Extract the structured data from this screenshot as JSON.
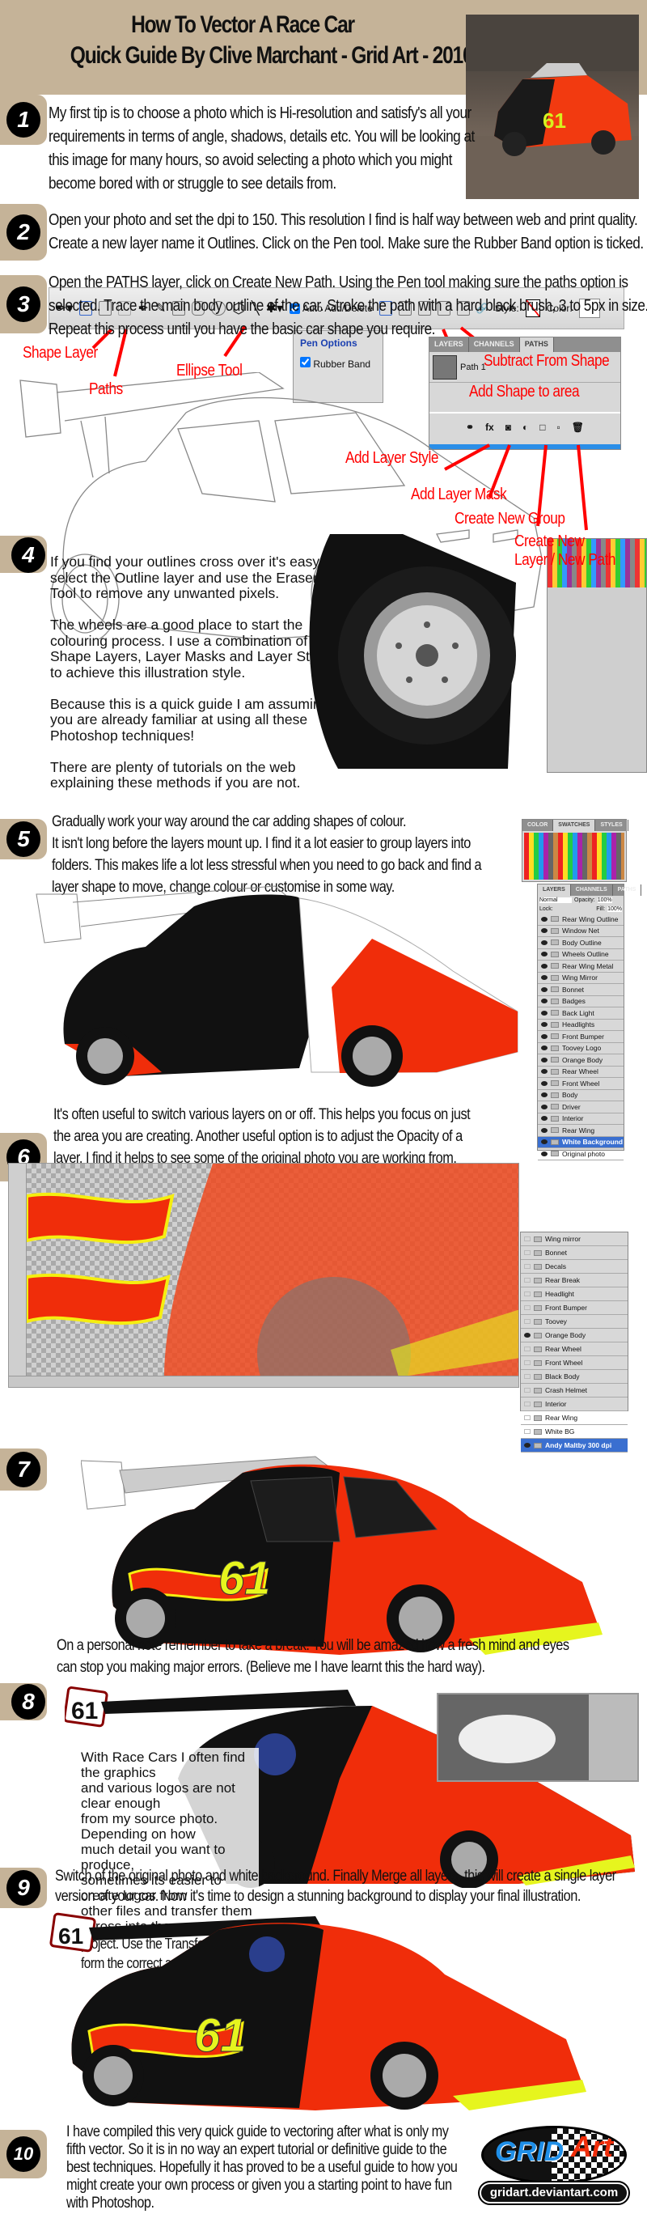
{
  "header": {
    "title_line1": "How To Vector A Race Car",
    "title_line2": "Quick Guide By Clive Marchant - Grid Art - 2010"
  },
  "colors": {
    "band": "#c5b398",
    "annotation": "#ff0000",
    "car_orange": "#f03a10",
    "car_black": "#111111",
    "car_yellow": "#e6f51e"
  },
  "steps": [
    {
      "num": "1",
      "lines": [
        "My first tip is to choose a photo which is Hi-resolution and satisfy's all your",
        "requirements in terms of angle, shadows, details etc. You will be looking at",
        "this image for many hours, so avoid selecting a photo which you might",
        "become bored with or struggle to see details from."
      ]
    },
    {
      "num": "2",
      "lines": [
        "Open your photo and set the dpi to 150. This resolution I find is half way between web and print quality.",
        "Create a new layer name it Outlines. Click on the Pen tool. Make sure the Rubber Band option is ticked."
      ]
    },
    {
      "num": "3",
      "lines": [
        "Open the PATHS layer, click on Create New Path. Using the Pen tool making sure the paths option is",
        "selected. Trace the main body outline of the car. Stroke the path with a hard black brush, 3 to 5px in size.",
        "Repeat this process until you have the basic car shape you require."
      ]
    },
    {
      "num": "4",
      "lines": [
        "If you find your outlines cross over it's easy to",
        "select the Outline layer and use the Eraser",
        "Tool to remove any unwanted pixels.",
        "",
        "The wheels are a good place to start the",
        "colouring process. I use a combination of",
        "Shape Layers, Layer Masks and Layer Styles",
        "to achieve this illustration style.",
        "",
        "Because this is a quick guide I am assuming",
        "you are already familiar at using  all these",
        "Photoshop techniques!",
        "",
        "There are plenty of tutorials on the web",
        "explaining these methods if you are not."
      ]
    },
    {
      "num": "5",
      "lines": [
        "Gradually work your way around the car adding shapes of colour.",
        "It isn't long before the layers mount up. I find it a lot easier to group layers into",
        "folders. This makes life a lot less stressful when you need to go back and find a",
        "layer shape to move, change colour or customise in some way."
      ]
    },
    {
      "num": "6",
      "lines": [
        "It's often useful to switch various layers on or off. This helps you focus on just",
        "the area you are creating. Another useful option is to adjust the Opacity of a",
        "layer. I find it helps to see some of the original photo you are working from."
      ]
    },
    {
      "num": "7",
      "lines": [
        "On a personal note remember to take a break. You will be amazed how a fresh mind and eyes",
        "can stop you making major errors. (Believe me I have learnt this the hard way)."
      ]
    },
    {
      "num": "8",
      "lines": [
        "With Race Cars I often find the graphics",
        "and various logos are not clear enough",
        "from my source photo. Depending on how",
        "much detail you want to produce,",
        "sometimes its easier to create logos from",
        "other files and transfer them across into the",
        "project. Use the Transform / Warp mode to",
        "form the correct angle."
      ]
    },
    {
      "num": "9",
      "lines": [
        "Switch of the original photo and white background. Finally Merge all layers, this will create a single layer",
        "version of your car. Now it's time to design a stunning background to display your final illustration."
      ]
    },
    {
      "num": "10",
      "lines": [
        "I have compiled this very quick guide to vectoring after what is only my",
        "fifth vector. So it is in no way an expert tutorial or definitive guide to the",
        "best techniques. Hopefully it has proved to be a useful guide to how you",
        "might create your own process or given you a starting point to have fun",
        "with Photoshop."
      ]
    }
  ],
  "toolbar": {
    "auto_add_delete": "Auto Add/Delete",
    "style_label": "Style:",
    "color_label": "Color:",
    "pen_options_title": "Pen Options",
    "rubber_band": "Rubber Band",
    "annotations": {
      "shape_layer": "Shape Layer",
      "paths": "Paths",
      "ellipse_tool": "Ellipse Tool",
      "subtract": "Subtract From Shape",
      "add_shape": "Add Shape to area"
    }
  },
  "paths_panel": {
    "tabs": [
      "LAYERS",
      "CHANNELS",
      "PATHS"
    ],
    "path_name": "Path 1",
    "annotations": {
      "layer_style": "Add Layer Style",
      "layer_mask": "Add Layer Mask",
      "new_group": "Create New Group",
      "new_layer_1": "Create New",
      "new_layer_2": "Layer / New Path"
    }
  },
  "layers_panel_5": {
    "tabs": [
      "LAYERS",
      "CHANNELS",
      "PATHS"
    ],
    "swatch_tabs": [
      "COLOR",
      "SWATCHES",
      "STYLES"
    ],
    "blend": "Normal",
    "opacity_label": "Opacity:",
    "opacity": "100%",
    "lock_label": "Lock:",
    "fill_label": "Fill:",
    "fill": "100%",
    "layers": [
      "Rear Wing Outline",
      "Window Net",
      "Body Outline",
      "Wheels Outline",
      "Rear Wing Metal",
      "Wing Mirror",
      "Bonnet",
      "Badges",
      "Back Light",
      "Headlights",
      "Front Bumper",
      "Toovey Logo",
      "Orange Body",
      "Rear Wheel",
      "Front Wheel",
      "Body",
      "Driver",
      "Interior",
      "Rear Wing",
      "White Background",
      "Original photo"
    ]
  },
  "layers_panel_6": {
    "layers": [
      "Wing mirror",
      "Bonnet",
      "Decals",
      "Rear Break",
      "Headlight",
      "Front Bumper",
      "Toovey",
      "Orange Body",
      "Rear Wheel",
      "Front Wheel",
      "Black Body",
      "Crash Helmet",
      "Interior",
      "Rear Wing",
      "White BG",
      "Andy Maltby 300 dpi"
    ]
  },
  "car": {
    "number": "61"
  },
  "logo": {
    "text_grid": "GRID",
    "text_art": "Art",
    "url": "gridart.deviantart.com"
  }
}
